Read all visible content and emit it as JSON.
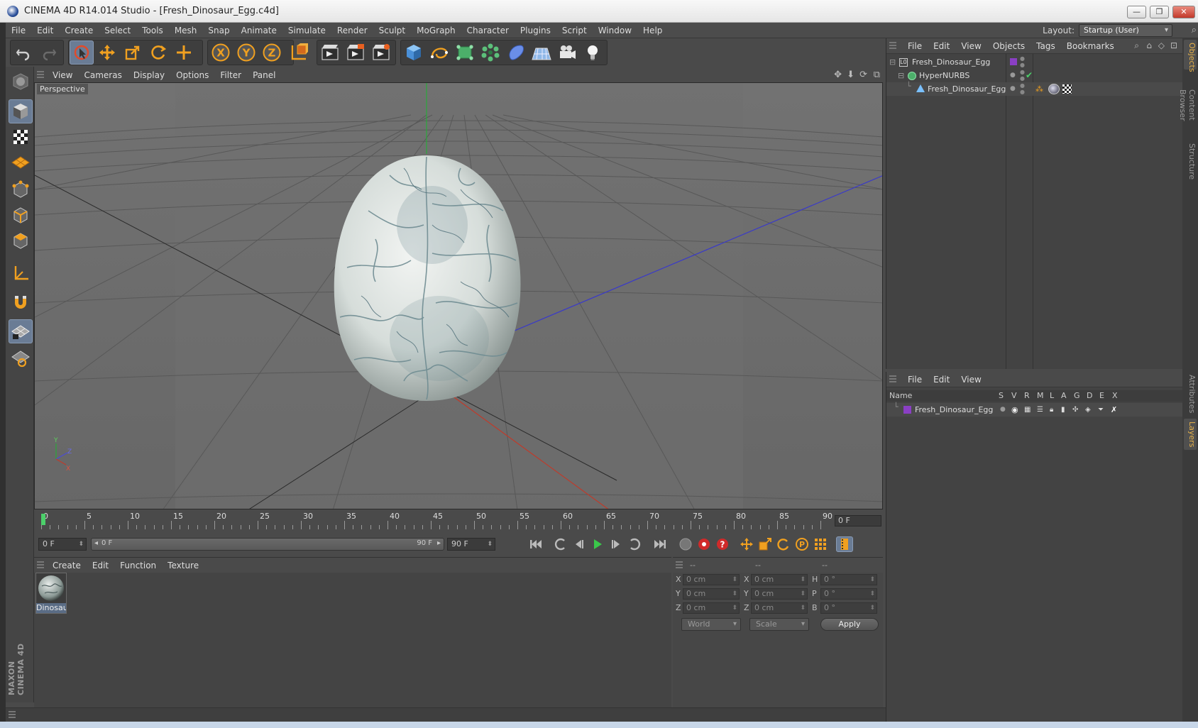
{
  "window": {
    "title": "CINEMA 4D R14.014 Studio - [Fresh_Dinosaur_Egg.c4d]",
    "minimize": "—",
    "restore": "❐",
    "close": "✕"
  },
  "menubar": {
    "items": [
      "File",
      "Edit",
      "Create",
      "Select",
      "Tools",
      "Mesh",
      "Snap",
      "Animate",
      "Simulate",
      "Render",
      "Sculpt",
      "MoGraph",
      "Character",
      "Plugins",
      "Script",
      "Window",
      "Help"
    ],
    "layout_label": "Layout:",
    "layout_value": "Startup (User)"
  },
  "toolbar": {
    "icons": [
      "undo-icon",
      "redo-icon",
      "live-selection-icon",
      "move-icon",
      "scale-icon",
      "rotate-icon",
      "add-object-icon",
      "x-axis-icon",
      "y-axis-icon",
      "z-axis-icon",
      "coordinate-system-icon",
      "render-view-icon",
      "render-picture-viewer-icon",
      "edit-render-settings-icon",
      "cube-icon",
      "spline-pen-icon",
      "nurbs-icon",
      "array-icon",
      "deformer-icon",
      "floor-icon",
      "camera-icon",
      "light-icon"
    ],
    "axis_x": "X",
    "axis_y": "Y",
    "axis_z": "Z"
  },
  "viewport": {
    "menu": [
      "View",
      "Cameras",
      "Display",
      "Options",
      "Filter",
      "Panel"
    ],
    "label": "Perspective",
    "axis_labels": {
      "y": "Y",
      "z": "Z",
      "x": "X"
    }
  },
  "timeline": {
    "ticks": [
      "0",
      "5",
      "10",
      "15",
      "20",
      "25",
      "30",
      "35",
      "40",
      "45",
      "50",
      "55",
      "60",
      "65",
      "70",
      "75",
      "80",
      "85",
      "90"
    ],
    "current_frame": "0 F",
    "start_field": "0 F",
    "range_start": "0 F",
    "range_end": "90 F",
    "end_field": "90 F"
  },
  "materials": {
    "menu": [
      "Create",
      "Edit",
      "Function",
      "Texture"
    ],
    "items": [
      {
        "name": "Dinosau"
      }
    ]
  },
  "coordinates": {
    "headers": [
      "--",
      "--",
      "--"
    ],
    "rows": [
      {
        "a": "X",
        "av": "0 cm",
        "b": "X",
        "bv": "0 cm",
        "c": "H",
        "cv": "0 °"
      },
      {
        "a": "Y",
        "av": "0 cm",
        "b": "Y",
        "bv": "0 cm",
        "c": "P",
        "cv": "0 °"
      },
      {
        "a": "Z",
        "av": "0 cm",
        "b": "Z",
        "bv": "0 cm",
        "c": "B",
        "cv": "0 °"
      }
    ],
    "mode": "World",
    "size_mode": "Scale",
    "apply": "Apply"
  },
  "object_manager": {
    "menu": [
      "File",
      "Edit",
      "View",
      "Objects",
      "Tags",
      "Bookmarks"
    ],
    "objects": [
      {
        "name": "Fresh_Dinosaur_Egg",
        "depth": 0,
        "icon": "null-object-icon"
      },
      {
        "name": "HyperNURBS",
        "depth": 1,
        "icon": "hypernurbs-icon"
      },
      {
        "name": "Fresh_Dinosaur_Egg",
        "depth": 2,
        "icon": "polygon-object-icon"
      }
    ]
  },
  "layer_manager": {
    "menu": [
      "File",
      "Edit",
      "View"
    ],
    "columns": [
      "Name",
      "S",
      "V",
      "R",
      "M",
      "L",
      "A",
      "G",
      "D",
      "E",
      "X"
    ],
    "layers": [
      {
        "name": "Fresh_Dinosaur_Egg",
        "color": "#8a3fc4"
      }
    ]
  },
  "right_tabs": [
    "Objects",
    "Content Browser",
    "Structure",
    "Attributes",
    "Layers"
  ],
  "brand": {
    "logo": "MAXON CINEMA 4D"
  },
  "colors": {
    "accent_orange": "#f0a020",
    "active_blue": "#6a7c95",
    "layer_purple": "#8a3fc4"
  }
}
